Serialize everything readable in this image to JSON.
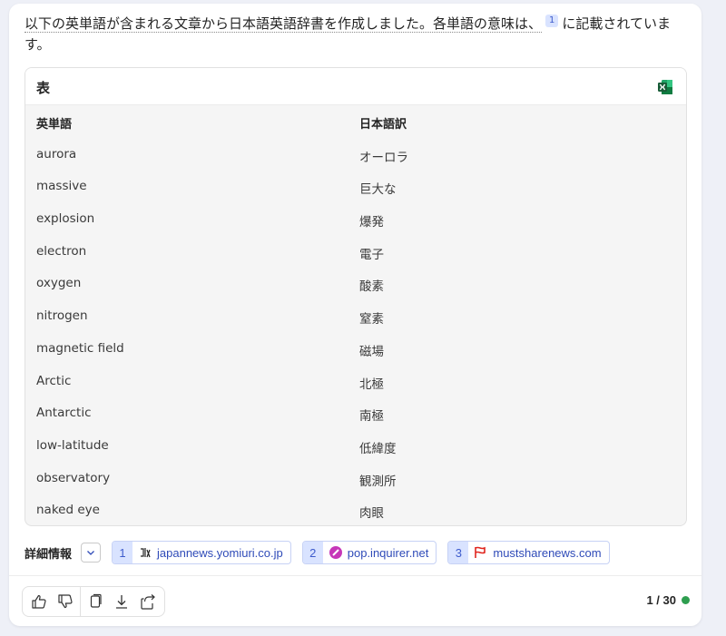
{
  "intro": {
    "text_part1": "以下の英単語が含まれる文章から日本語英語辞書を作成しました。各単語の意味は、",
    "citation": "1",
    "text_part2": "に記載されています。"
  },
  "table": {
    "title": "表",
    "export_icon": "excel-icon",
    "headers": [
      "英単語",
      "日本語訳"
    ],
    "rows": [
      [
        "aurora",
        "オーロラ"
      ],
      [
        "massive",
        "巨大な"
      ],
      [
        "explosion",
        "爆発"
      ],
      [
        "electron",
        "電子"
      ],
      [
        "oxygen",
        "酸素"
      ],
      [
        "nitrogen",
        "窒素"
      ],
      [
        "magnetic field",
        "磁場"
      ],
      [
        "Arctic",
        "北極"
      ],
      [
        "Antarctic",
        "南極"
      ],
      [
        "low-latitude",
        "低緯度"
      ],
      [
        "observatory",
        "観測所"
      ],
      [
        "naked eye",
        "肉眼"
      ]
    ]
  },
  "details": {
    "label": "詳細情報",
    "sources": [
      {
        "num": "1",
        "domain": "japannews.yomiuri.co.jp",
        "icon": "yomiuri-icon"
      },
      {
        "num": "2",
        "domain": "pop.inquirer.net",
        "icon": "inquirer-icon"
      },
      {
        "num": "3",
        "domain": "mustsharenews.com",
        "icon": "mustsharenews-icon"
      }
    ]
  },
  "footer": {
    "counter": "1 / 30",
    "status_color": "#2e9e4f"
  },
  "colors": {
    "accent": "#3d5bcc",
    "citation_bg": "#d9e3ff"
  }
}
